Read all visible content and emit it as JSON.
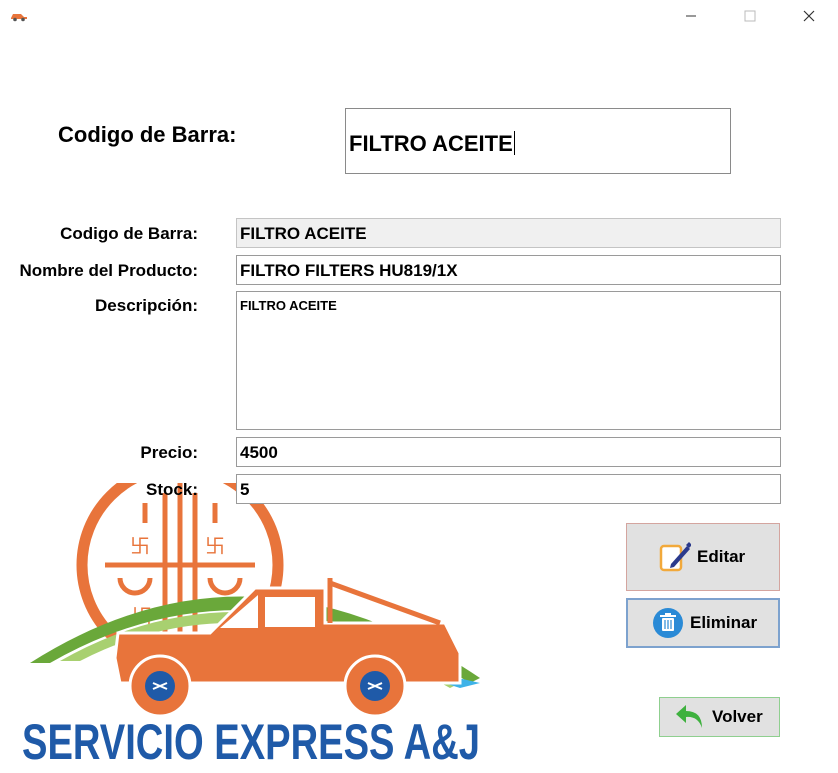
{
  "window": {
    "minimize_glyph": "—",
    "maximize_glyph": "☐",
    "close_glyph": "✕",
    "app_icon": "car-icon"
  },
  "search": {
    "label": "Codigo de Barra:",
    "value": "FILTRO ACEITE"
  },
  "form": {
    "codigo_label": "Codigo de Barra:",
    "codigo_value": "FILTRO ACEITE",
    "nombre_label": "Nombre del Producto:",
    "nombre_value": "FILTRO FILTERS HU819/1X",
    "descripcion_label": "Descripción:",
    "descripcion_value": "FILTRO ACEITE",
    "precio_label": "Precio:",
    "precio_value": "4500",
    "stock_label": "Stock:",
    "stock_value": "5"
  },
  "buttons": {
    "editar": "Editar",
    "eliminar": "Eliminar",
    "volver": "Volver"
  },
  "logo": {
    "text": "SERVICIO EXPRESS A&J",
    "colors": {
      "orange": "#e8743b",
      "green": "#6aa83a",
      "blue": "#1f5aa8"
    }
  }
}
